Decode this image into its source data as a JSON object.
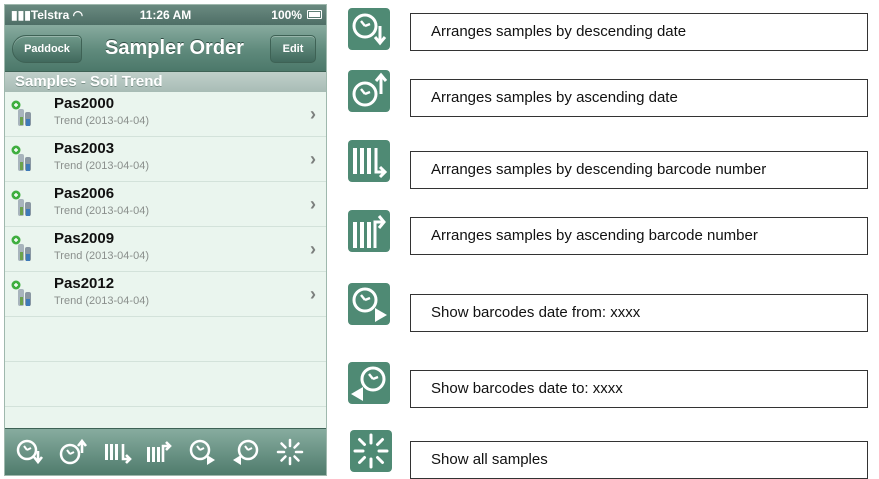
{
  "status_bar": {
    "carrier": "Telstra",
    "time": "11:26 AM",
    "battery": "100%"
  },
  "nav": {
    "back_label": "Paddock",
    "title": "Sampler Order",
    "edit_label": "Edit"
  },
  "section_header": "Samples - Soil Trend",
  "samples": [
    {
      "title": "Pas2000",
      "subtitle": "Trend (2013-04-04)"
    },
    {
      "title": "Pas2003",
      "subtitle": "Trend (2013-04-04)"
    },
    {
      "title": "Pas2006",
      "subtitle": "Trend (2013-04-04)"
    },
    {
      "title": "Pas2009",
      "subtitle": "Trend (2013-04-04)"
    },
    {
      "title": "Pas2012",
      "subtitle": "Trend (2013-04-04)"
    }
  ],
  "toolbar_icons": [
    "sort-date-descending-icon",
    "sort-date-ascending-icon",
    "sort-barcode-descending-icon",
    "sort-barcode-ascending-icon",
    "date-from-icon",
    "date-to-icon",
    "show-all-icon"
  ],
  "legend": [
    {
      "icon": "sort-date-descending-icon",
      "text": "Arranges samples by descending date"
    },
    {
      "icon": "sort-date-ascending-icon",
      "text": "Arranges samples by ascending date"
    },
    {
      "icon": "sort-barcode-descending-icon",
      "text": "Arranges samples by descending barcode number"
    },
    {
      "icon": "sort-barcode-ascending-icon",
      "text": "Arranges samples by ascending barcode number"
    },
    {
      "icon": "date-from-icon",
      "text": "Show barcodes date from: xxxx"
    },
    {
      "icon": "date-to-icon",
      "text": "Show barcodes date to: xxxx"
    },
    {
      "icon": "show-all-icon",
      "text": "Show all samples"
    }
  ],
  "colors": {
    "accent": "#5f8a7c",
    "list_background": "#eaf5ee",
    "icon_tile": "#4f8a74"
  }
}
